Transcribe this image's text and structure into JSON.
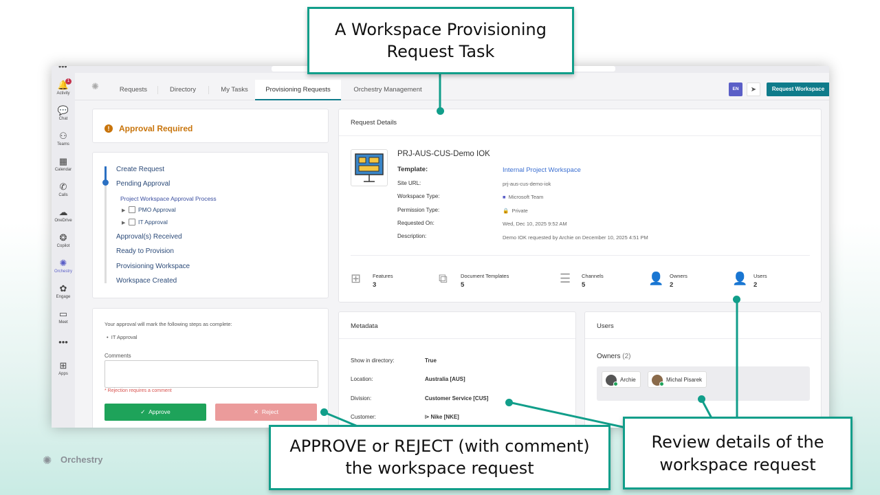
{
  "callouts": {
    "top": "A Workspace Provisioning Request Task",
    "bottom_left": "APPROVE or REJECT (with comment) the workspace request",
    "bottom_right": "Review details of the workspace request"
  },
  "brand": "Orchestry",
  "teams_rail": [
    {
      "label": "Activity",
      "icon": "bell-icon",
      "badge": "1"
    },
    {
      "label": "Chat",
      "icon": "chat-icon"
    },
    {
      "label": "Teams",
      "icon": "teams-icon"
    },
    {
      "label": "Calendar",
      "icon": "calendar-icon"
    },
    {
      "label": "Calls",
      "icon": "phone-icon"
    },
    {
      "label": "OneDrive",
      "icon": "cloud-icon"
    },
    {
      "label": "Copilot",
      "icon": "copilot-icon"
    },
    {
      "label": "Orchestry",
      "icon": "orchestry-icon"
    },
    {
      "label": "Engage",
      "icon": "engage-icon"
    },
    {
      "label": "Meet",
      "icon": "video-icon"
    },
    {
      "label": "Apps",
      "icon": "plus-box-icon"
    }
  ],
  "tabs": [
    "Requests",
    "Directory",
    "My Tasks",
    "Provisioning Requests",
    "Orchestry Management"
  ],
  "header": {
    "lang": "EN",
    "request_button": "Request Workspace"
  },
  "approval": {
    "title": "Approval Required",
    "steps": {
      "create": "Create Request",
      "pending": "Pending Approval",
      "process": "Project Workspace Approval Process",
      "pmo": "PMO Approval",
      "it": "IT Approval",
      "received": "Approval(s) Received",
      "ready": "Ready to Provision",
      "provisioning": "Provisioning Workspace",
      "created": "Workspace Created"
    },
    "note": "Your approval will mark the following steps as complete:",
    "note_item": "IT Approval",
    "comments_label": "Comments",
    "rejection_note": "* Rejection requires a comment",
    "approve": "Approve",
    "reject": "Reject"
  },
  "details": {
    "title": "Request Details",
    "name": "PRJ-AUS-CUS-Demo IOK",
    "template_label": "Template:",
    "template_value": "Internal Project Workspace",
    "url_label": "Site URL:",
    "url_value": "prj-aus-cus-demo-iok",
    "type_label": "Workspace Type:",
    "type_value": "Microsoft Team",
    "perm_label": "Permission Type:",
    "perm_value": "Private",
    "requested_label": "Requested On:",
    "requested_value": "Wed, Dec 10, 2025 9:52 AM",
    "desc_label": "Description:",
    "desc_value": "Demo IOK requested by Archie on December 10, 2025 4:51 PM",
    "stats": [
      {
        "label": "Features",
        "value": "3"
      },
      {
        "label": "Document Templates",
        "value": "5"
      },
      {
        "label": "Channels",
        "value": "5"
      },
      {
        "label": "Owners",
        "value": "2"
      },
      {
        "label": "Users",
        "value": "2"
      }
    ]
  },
  "metadata": {
    "title": "Metadata",
    "rows": [
      {
        "key": "Show in directory:",
        "value": "True"
      },
      {
        "key": "Location:",
        "value": "Australia [AUS]"
      },
      {
        "key": "Division:",
        "value": "Customer Service [CUS]"
      },
      {
        "key": "Customer:",
        "value": "Nike [NKE]"
      }
    ]
  },
  "users": {
    "title": "Users",
    "owners_label": "Owners",
    "owners_count": "(2)",
    "owners": [
      "Archie",
      "Michal Pisarek"
    ]
  },
  "colors": {
    "accent": "#0f7b8a",
    "callout_border": "#119e8a",
    "warning": "#c8740b",
    "approve": "#1ea35a",
    "reject": "#eb9b9b"
  }
}
